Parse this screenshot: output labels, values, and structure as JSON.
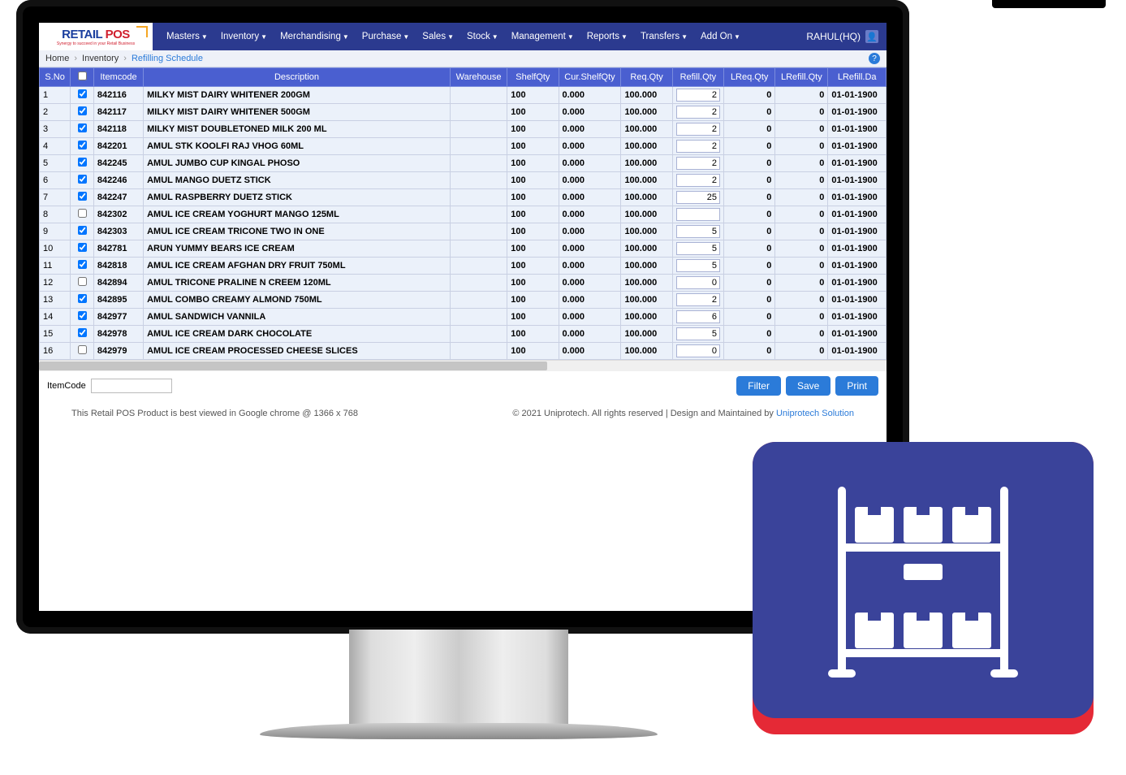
{
  "logo": {
    "text1": "RETAIL",
    "text2": "POS",
    "tagline": "Synergy to succeed in your Retail Business"
  },
  "nav": [
    "Masters",
    "Inventory",
    "Merchandising",
    "Purchase",
    "Sales",
    "Stock",
    "Management",
    "Reports",
    "Transfers",
    "Add On"
  ],
  "user": "RAHUL(HQ)",
  "breadcrumb": {
    "home": "Home",
    "inventory": "Inventory",
    "page": "Refilling Schedule"
  },
  "columns": [
    "S.No",
    "",
    "Itemcode",
    "Description",
    "Warehouse",
    "ShelfQty",
    "Cur.ShelfQty",
    "Req.Qty",
    "Refill.Qty",
    "LReq.Qty",
    "LRefill.Qty",
    "LRefill.Da"
  ],
  "rows": [
    {
      "no": "1",
      "chk": true,
      "code": "842116",
      "desc": "MILKY MIST DAIRY WHITENER 200GM",
      "wh": "",
      "shelf": "100",
      "cur": "0.000",
      "req": "100.000",
      "refill": "2",
      "lreq": "0",
      "lrefill": "0",
      "ldate": "01-01-1900"
    },
    {
      "no": "2",
      "chk": true,
      "code": "842117",
      "desc": "MILKY MIST DAIRY WHITENER 500GM",
      "wh": "",
      "shelf": "100",
      "cur": "0.000",
      "req": "100.000",
      "refill": "2",
      "lreq": "0",
      "lrefill": "0",
      "ldate": "01-01-1900"
    },
    {
      "no": "3",
      "chk": true,
      "code": "842118",
      "desc": "MILKY MIST DOUBLETONED MILK 200 ML",
      "wh": "",
      "shelf": "100",
      "cur": "0.000",
      "req": "100.000",
      "refill": "2",
      "lreq": "0",
      "lrefill": "0",
      "ldate": "01-01-1900"
    },
    {
      "no": "4",
      "chk": true,
      "code": "842201",
      "desc": "AMUL STK KOOLFI RAJ VHOG 60ML",
      "wh": "",
      "shelf": "100",
      "cur": "0.000",
      "req": "100.000",
      "refill": "2",
      "lreq": "0",
      "lrefill": "0",
      "ldate": "01-01-1900"
    },
    {
      "no": "5",
      "chk": true,
      "code": "842245",
      "desc": "AMUL JUMBO CUP KINGAL PHOSO",
      "wh": "",
      "shelf": "100",
      "cur": "0.000",
      "req": "100.000",
      "refill": "2",
      "lreq": "0",
      "lrefill": "0",
      "ldate": "01-01-1900"
    },
    {
      "no": "6",
      "chk": true,
      "code": "842246",
      "desc": "AMUL MANGO DUETZ STICK",
      "wh": "",
      "shelf": "100",
      "cur": "0.000",
      "req": "100.000",
      "refill": "2",
      "lreq": "0",
      "lrefill": "0",
      "ldate": "01-01-1900"
    },
    {
      "no": "7",
      "chk": true,
      "code": "842247",
      "desc": "AMUL RASPBERRY DUETZ STICK",
      "wh": "",
      "shelf": "100",
      "cur": "0.000",
      "req": "100.000",
      "refill": "25",
      "lreq": "0",
      "lrefill": "0",
      "ldate": "01-01-1900"
    },
    {
      "no": "8",
      "chk": false,
      "code": "842302",
      "desc": "AMUL ICE CREAM YOGHURT MANGO 125ML",
      "wh": "",
      "shelf": "100",
      "cur": "0.000",
      "req": "100.000",
      "refill": "",
      "lreq": "0",
      "lrefill": "0",
      "ldate": "01-01-1900"
    },
    {
      "no": "9",
      "chk": true,
      "code": "842303",
      "desc": "AMUL ICE CREAM TRICONE TWO IN ONE",
      "wh": "",
      "shelf": "100",
      "cur": "0.000",
      "req": "100.000",
      "refill": "5",
      "lreq": "0",
      "lrefill": "0",
      "ldate": "01-01-1900"
    },
    {
      "no": "10",
      "chk": true,
      "code": "842781",
      "desc": "ARUN YUMMY BEARS ICE CREAM",
      "wh": "",
      "shelf": "100",
      "cur": "0.000",
      "req": "100.000",
      "refill": "5",
      "lreq": "0",
      "lrefill": "0",
      "ldate": "01-01-1900"
    },
    {
      "no": "11",
      "chk": true,
      "code": "842818",
      "desc": "AMUL ICE CREAM AFGHAN DRY FRUIT 750ML",
      "wh": "",
      "shelf": "100",
      "cur": "0.000",
      "req": "100.000",
      "refill": "5",
      "lreq": "0",
      "lrefill": "0",
      "ldate": "01-01-1900"
    },
    {
      "no": "12",
      "chk": false,
      "code": "842894",
      "desc": "AMUL TRICONE PRALINE N CREEM 120ML",
      "wh": "",
      "shelf": "100",
      "cur": "0.000",
      "req": "100.000",
      "refill": "0",
      "lreq": "0",
      "lrefill": "0",
      "ldate": "01-01-1900"
    },
    {
      "no": "13",
      "chk": true,
      "code": "842895",
      "desc": "AMUL COMBO CREAMY ALMOND 750ML",
      "wh": "",
      "shelf": "100",
      "cur": "0.000",
      "req": "100.000",
      "refill": "2",
      "lreq": "0",
      "lrefill": "0",
      "ldate": "01-01-1900"
    },
    {
      "no": "14",
      "chk": true,
      "code": "842977",
      "desc": "AMUL SANDWICH VANNILA",
      "wh": "",
      "shelf": "100",
      "cur": "0.000",
      "req": "100.000",
      "refill": "6",
      "lreq": "0",
      "lrefill": "0",
      "ldate": "01-01-1900"
    },
    {
      "no": "15",
      "chk": true,
      "code": "842978",
      "desc": "AMUL ICE CREAM DARK CHOCOLATE",
      "wh": "",
      "shelf": "100",
      "cur": "0.000",
      "req": "100.000",
      "refill": "5",
      "lreq": "0",
      "lrefill": "0",
      "ldate": "01-01-1900"
    },
    {
      "no": "16",
      "chk": false,
      "code": "842979",
      "desc": "AMUL ICE CREAM PROCESSED CHEESE SLICES",
      "wh": "",
      "shelf": "100",
      "cur": "0.000",
      "req": "100.000",
      "refill": "0",
      "lreq": "0",
      "lrefill": "0",
      "ldate": "01-01-1900"
    }
  ],
  "footer_controls": {
    "label": "ItemCode",
    "filter": "Filter",
    "save": "Save",
    "print": "Print"
  },
  "footer_info": {
    "left": "This Retail POS Product is best viewed in Google chrome @ 1366 x 768",
    "right_pre": "© 2021 Uniprotech. All rights reserved | Design and Maintained by ",
    "right_link": "Uniprotech Solution"
  }
}
